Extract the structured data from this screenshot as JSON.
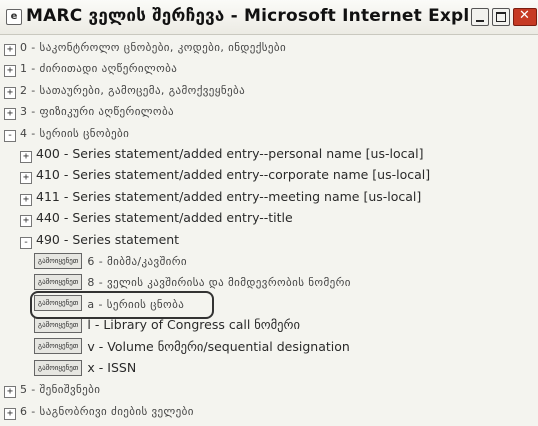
{
  "window": {
    "title": "MARC ველის შერჩევა - Microsoft Internet Expl..."
  },
  "tree": {
    "toggle_plus": "+",
    "toggle_minus": "-",
    "button_label": "გამოიყენეთ",
    "rows": [
      {
        "text": "0 - საკონტროლო ცნობები, კოდები, ინდექსები"
      },
      {
        "text": "1 - ძირითადი აღწერილობა"
      },
      {
        "text": "2 - სათაურები, გამოცემა, გამოქვეყნება"
      },
      {
        "text": "3 - ფიზიკური აღწერილობა"
      },
      {
        "text": "4 - სერიის ცნობები"
      },
      {
        "text": "400 - Series statement/added entry--personal name [us-local]"
      },
      {
        "text": "410 - Series statement/added entry--corporate name [us-local]"
      },
      {
        "text": "411 - Series statement/added entry--meeting name [us-local]"
      },
      {
        "text": "440 - Series statement/added entry--title"
      },
      {
        "text": "490 - Series statement"
      },
      {
        "text": "6 - მიბმა/კავშირი"
      },
      {
        "text": "8 - ველის კავშირისა და მიმდევრობის ნომერი"
      },
      {
        "text": "a - სერიის ცნობა"
      },
      {
        "text": "l - Library of Congress call ნომერი"
      },
      {
        "text": "v - Volume ნომერი/sequential designation"
      },
      {
        "text": "x - ISSN"
      },
      {
        "text": "5 - შენიშვნები"
      },
      {
        "text": "6 - საგნობრივი ძიების ველები"
      }
    ]
  }
}
